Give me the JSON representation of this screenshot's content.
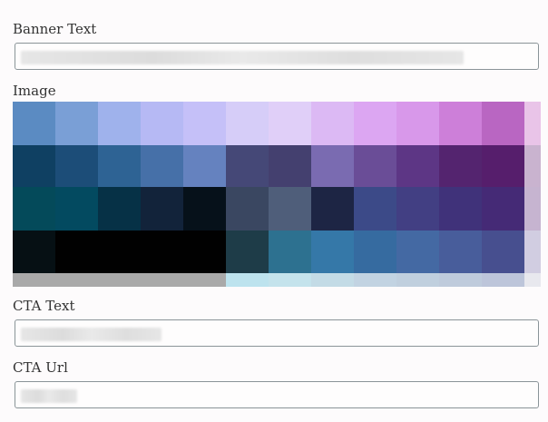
{
  "form": {
    "banner_text_label": "Banner Text",
    "image_label": "Image",
    "cta_text_label": "CTA Text",
    "cta_url_label": "CTA Url"
  },
  "image_palette": [
    [
      "#5b8bc2",
      "#7a9fd6",
      "#9fb2ec",
      "#b6b9f4",
      "#c5c0f8",
      "#d6cdf8",
      "#e0cff8",
      "#dcb9f4",
      "#dca6f2",
      "#d898ea",
      "#cd7fd9",
      "#b966c2",
      "#e9c4e8"
    ],
    [
      "#0f4062",
      "#1c4d78",
      "#2e6394",
      "#4670a8",
      "#6582bf",
      "#454877",
      "#44406f",
      "#7a6bb1",
      "#6a4d97",
      "#5d3685",
      "#54246f",
      "#561e6c",
      "#c9b3cf"
    ],
    [
      "#044a5a",
      "#034a60",
      "#063146",
      "#12233a",
      "#06111a",
      "#3a4761",
      "#4f5e7a",
      "#1d2544",
      "#3c4a88",
      "#423f83",
      "#40327a",
      "#452a76",
      "#c6b4d0"
    ],
    [
      "#061014",
      "#010101",
      "#010101",
      "#010101",
      "#010101",
      "#1e3c48",
      "#2d7190",
      "#3578a8",
      "#366ba0",
      "#4469a3",
      "#485d9b",
      "#474f8f",
      "#d1cde1"
    ],
    [
      "#a9a9a9",
      "#a9a9a9",
      "#a9a9a9",
      "#a9a9a9",
      "#a9a9a9",
      "#bde3ee",
      "#c4e3ec",
      "#c3dbe6",
      "#c2d3e2",
      "#c0cfde",
      "#bfcbdc",
      "#bdc5da",
      "#e8e8ee"
    ]
  ]
}
